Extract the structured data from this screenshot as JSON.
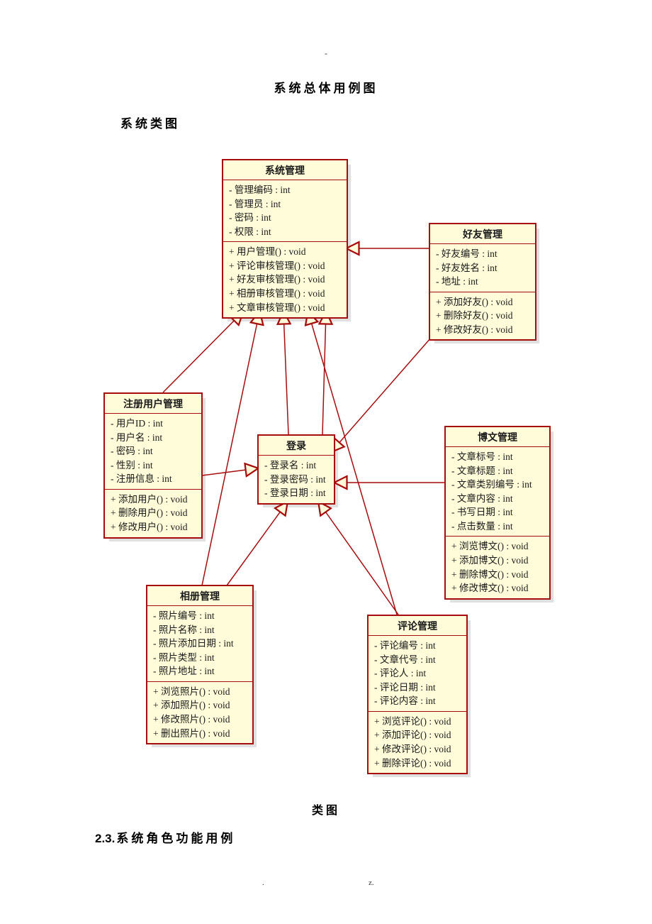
{
  "page": {
    "dash": "-",
    "title_top": "系统总体用例图",
    "h_classdiagram": "系统类图",
    "caption_classdiagram": "类图",
    "h_section": "系统角色功能用例",
    "section_num": "2.3.",
    "footer_dot": ".",
    "footer_z": "z."
  },
  "classes": {
    "sysmgmt": {
      "name": "系统管理",
      "attrs": [
        "- 管理编码 : int",
        "- 管理员 : int",
        "- 密码 : int",
        "- 权限 : int"
      ],
      "ops": [
        "+ 用户管理() : void",
        "+ 评论审核管理() : void",
        "+ 好友审核管理() : void",
        "+ 相册审核管理() : void",
        "+ 文章审核管理() : void"
      ]
    },
    "friend": {
      "name": "好友管理",
      "attrs": [
        "- 好友编号 : int",
        "- 好友姓名 : int",
        "- 地址 : int"
      ],
      "ops": [
        "+ 添加好友() : void",
        "+ 删除好友() : void",
        "+ 修改好友() : void"
      ]
    },
    "reg": {
      "name": "注册用户管理",
      "attrs": [
        "- 用户ID : int",
        "- 用户名 : int",
        "- 密码 : int",
        "- 性别 : int",
        "- 注册信息 : int"
      ],
      "ops": [
        "+ 添加用户() : void",
        "+ 删除用户() : void",
        "+ 修改用户() : void"
      ]
    },
    "login": {
      "name": "登录",
      "attrs": [
        "- 登录名 : int",
        "- 登录密码 : int",
        "- 登录日期 : int"
      ]
    },
    "blog": {
      "name": "博文管理",
      "attrs": [
        "- 文章标号 : int",
        "- 文章标题 : int",
        "- 文章类别编号 : int",
        "- 文章内容 : int",
        "- 书写日期 : int",
        "- 点击数量 : int"
      ],
      "ops": [
        "+ 浏览博文() : void",
        "+ 添加博文() : void",
        "+ 删除博文() : void",
        "+ 修改博文() : void"
      ]
    },
    "album": {
      "name": "相册管理",
      "attrs": [
        "- 照片编号 : int",
        "- 照片名称 : int",
        "- 照片添加日期 : int",
        "- 照片类型 : int",
        "- 照片地址 : int"
      ],
      "ops": [
        "+ 浏览照片() : void",
        "+ 添加照片() : void",
        "+ 修改照片() : void",
        "+ 删出照片() : void"
      ]
    },
    "comment": {
      "name": "评论管理",
      "attrs": [
        "- 评论编号 : int",
        "- 文章代号 : int",
        "- 评论人 : int",
        "- 评论日期 : int",
        "- 评论内容 : int"
      ],
      "ops": [
        "+ 浏览评论() : void",
        "+ 添加评论() : void",
        "+ 修改评论() : void",
        "+ 删除评论() : void"
      ]
    }
  }
}
